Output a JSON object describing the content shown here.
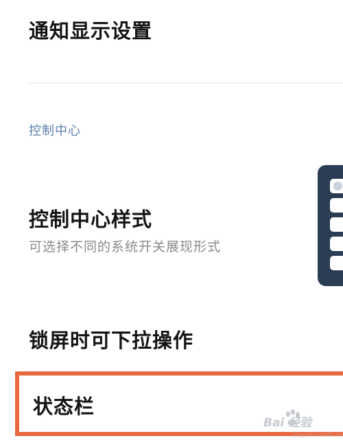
{
  "settings": {
    "notify_display": {
      "title": "通知显示设置"
    },
    "section_header": "控制中心",
    "control_center_style": {
      "title": "控制中心样式",
      "subtitle": "可选择不同的系统开关展现形式"
    },
    "lock_screen_pull": {
      "title": "锁屏时可下拉操作"
    },
    "status_bar": {
      "title": "状态栏"
    }
  },
  "preview": {
    "icon": "control-center-style-preview"
  },
  "watermark": {
    "brand": "Bai 经验",
    "url": "jingyan.baidu.com",
    "icon": "baidu-paw-icon"
  },
  "colors": {
    "highlight_border": "#e8693f",
    "section_header": "#5f7fae",
    "preview_bg": "#2b3d55"
  }
}
